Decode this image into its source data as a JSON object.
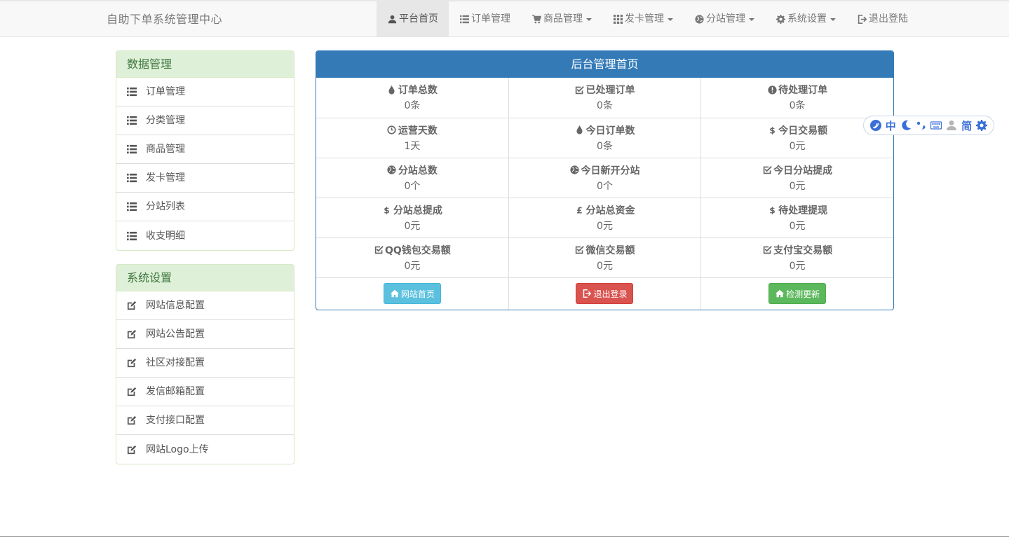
{
  "brand": "自助下单系统管理中心",
  "nav": [
    {
      "label": "平台首页",
      "icon": "user-icon",
      "active": true
    },
    {
      "label": "订单管理",
      "icon": "list-icon"
    },
    {
      "label": "商品管理",
      "icon": "cart-icon",
      "dropdown": true
    },
    {
      "label": "发卡管理",
      "icon": "grid-icon",
      "dropdown": true
    },
    {
      "label": "分站管理",
      "icon": "globe-icon",
      "dropdown": true
    },
    {
      "label": "系统设置",
      "icon": "gear-icon",
      "dropdown": true
    },
    {
      "label": "退出登陆",
      "icon": "logout-icon"
    }
  ],
  "data_panel": {
    "title": "数据管理",
    "items": [
      "订单管理",
      "分类管理",
      "商品管理",
      "发卡管理",
      "分站列表",
      "收支明细"
    ]
  },
  "settings_panel": {
    "title": "系统设置",
    "items": [
      "网站信息配置",
      "网站公告配置",
      "社区对接配置",
      "发信邮箱配置",
      "支付接口配置",
      "网站Logo上传"
    ]
  },
  "main": {
    "title": "后台管理首页",
    "rows": [
      [
        {
          "label": "订单总数",
          "value": "0条",
          "icon": "tint-icon"
        },
        {
          "label": "已处理订单",
          "value": "0条",
          "icon": "check-square-icon"
        },
        {
          "label": "待处理订单",
          "value": "0条",
          "icon": "exclamation-circle-icon"
        }
      ],
      [
        {
          "label": "运营天数",
          "value": "1天",
          "icon": "clock-icon"
        },
        {
          "label": "今日订单数",
          "value": "0条",
          "icon": "tint-icon"
        },
        {
          "label": "今日交易额",
          "value": "0元",
          "icon": "dollar-icon"
        }
      ],
      [
        {
          "label": "分站总数",
          "value": "0个",
          "icon": "globe-icon"
        },
        {
          "label": "今日新开分站",
          "value": "0个",
          "icon": "globe-icon"
        },
        {
          "label": "今日分站提成",
          "value": "0元",
          "icon": "check-square-icon"
        }
      ],
      [
        {
          "label": "分站总提成",
          "value": "0元",
          "icon": "dollar-icon"
        },
        {
          "label": "分站总资金",
          "value": "0元",
          "icon": "pound-icon"
        },
        {
          "label": "待处理提现",
          "value": "0元",
          "icon": "dollar-icon"
        }
      ],
      [
        {
          "label": "QQ钱包交易额",
          "value": "0元",
          "icon": "check-square-icon"
        },
        {
          "label": "微信交易额",
          "value": "0元",
          "icon": "check-square-icon"
        },
        {
          "label": "支付宝交易额",
          "value": "0元",
          "icon": "check-square-icon"
        }
      ]
    ],
    "buttons": [
      {
        "label": "网站首页",
        "icon": "home-icon",
        "color": "#5bc0de"
      },
      {
        "label": "退出登录",
        "icon": "logout-icon",
        "color": "#d9534f"
      },
      {
        "label": "检测更新",
        "icon": "home-icon",
        "color": "#5cb85c"
      }
    ]
  },
  "ime": {
    "items": [
      "logo-icon",
      "中",
      "moon-icon",
      "punctuation-icon",
      "keyboard-icon",
      "user-icon",
      "简",
      "gear-icon"
    ],
    "color": "#3a6fd8"
  }
}
